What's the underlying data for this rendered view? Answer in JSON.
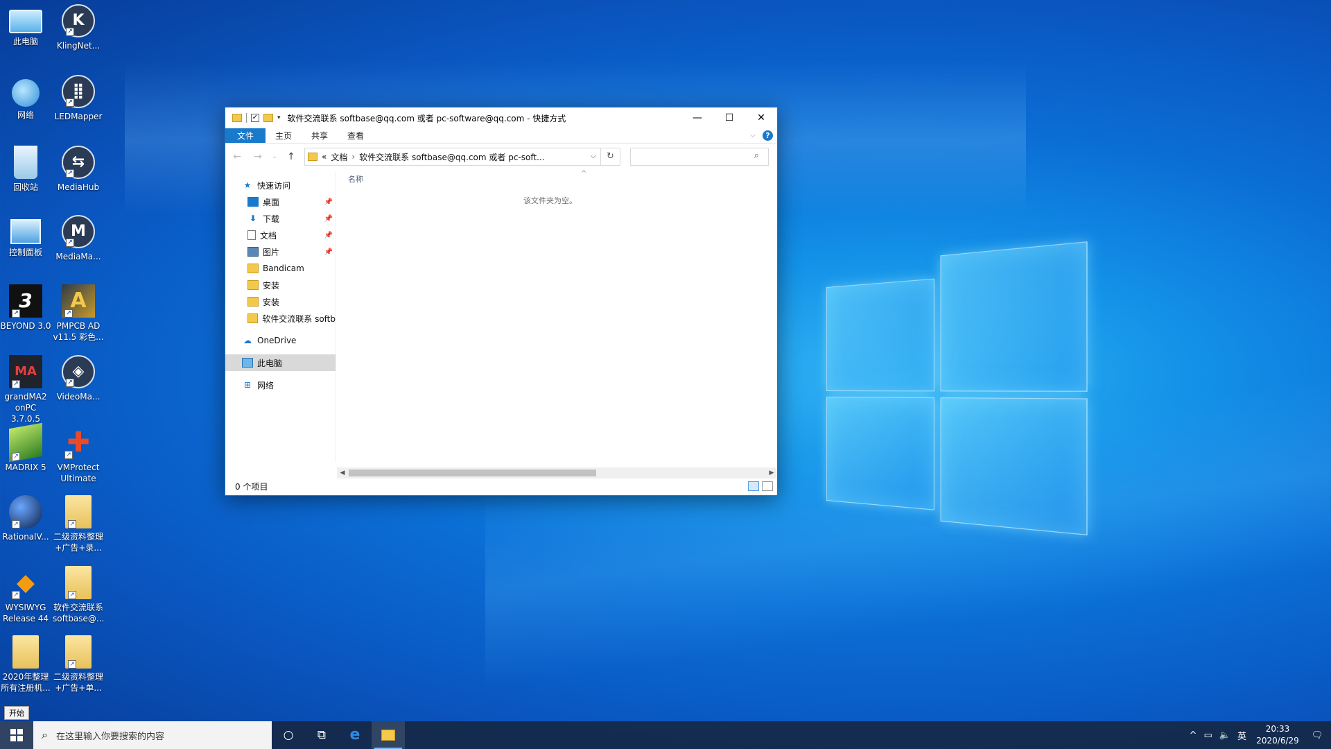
{
  "desktop": {
    "icons": [
      {
        "label": "此电脑",
        "icon": "computer-icon"
      },
      {
        "label": "KlingNet...",
        "icon": "klingnet-icon"
      },
      {
        "label": "网络",
        "icon": "network-icon"
      },
      {
        "label": "LEDMapper",
        "icon": "ledmapper-icon"
      },
      {
        "label": "回收站",
        "icon": "recycle-bin-icon"
      },
      {
        "label": "MediaHub",
        "icon": "mediahub-icon"
      },
      {
        "label": "控制面板",
        "icon": "control-panel-icon"
      },
      {
        "label": "MediaMa...",
        "icon": "mediamaster-icon"
      },
      {
        "label": "BEYOND 3.0",
        "icon": "beyond-icon"
      },
      {
        "label": "PMPCB AD\nv11.5 彩色...",
        "icon": "pmpcb-icon"
      },
      {
        "label": "grandMA2\nonPC 3.7.0.5",
        "icon": "grandma2-icon"
      },
      {
        "label": "VideoMa...",
        "icon": "videomapper-icon"
      },
      {
        "label": "MADRIX 5",
        "icon": "madrix-icon"
      },
      {
        "label": "VMProtect\nUltimate",
        "icon": "vmprotect-icon"
      },
      {
        "label": "RationalV...",
        "icon": "rational-icon"
      },
      {
        "label": "二级资料整理\n+广告+录...",
        "icon": "folder-shortcut-icon"
      },
      {
        "label": "WYSIWYG\nRelease 44",
        "icon": "wysiwyg-icon"
      },
      {
        "label": "软件交流联系\nsoftbase@...",
        "icon": "folder-shortcut-icon"
      },
      {
        "label": "2020年整理\n所有注册机...",
        "icon": "folder-icon"
      },
      {
        "label": "二级资料整理\n+广告+单...",
        "icon": "folder-shortcut-icon"
      }
    ],
    "start_tooltip": "开始"
  },
  "explorer": {
    "title": "软件交流联系 softbase@qq.com 或者 pc-software@qq.com - 快捷方式",
    "tabs": [
      "文件",
      "主页",
      "共享",
      "查看"
    ],
    "address": {
      "overflow": "«",
      "crumb1": "文档",
      "separator": "›",
      "crumb2": "软件交流联系 softbase@qq.com 或者 pc-soft..."
    },
    "search_placeholder": "",
    "nav": {
      "quick_access": "快速访问",
      "pinned": [
        {
          "label": "桌面",
          "icon": "desktop-folder-icon"
        },
        {
          "label": "下载",
          "icon": "download-icon"
        },
        {
          "label": "文档",
          "icon": "documents-icon"
        },
        {
          "label": "图片",
          "icon": "pictures-icon"
        }
      ],
      "recent": [
        "Bandicam",
        "安装",
        "安装",
        "软件交流联系 softb"
      ],
      "onedrive": "OneDrive",
      "this_pc": "此电脑",
      "network": "网络"
    },
    "column_name": "名称",
    "empty_text": "该文件夹为空。",
    "status": "0 个项目"
  },
  "taskbar": {
    "search_placeholder": "在这里输入你要搜索的内容",
    "ime": "英",
    "time": "20:33",
    "date": "2020/6/29"
  }
}
